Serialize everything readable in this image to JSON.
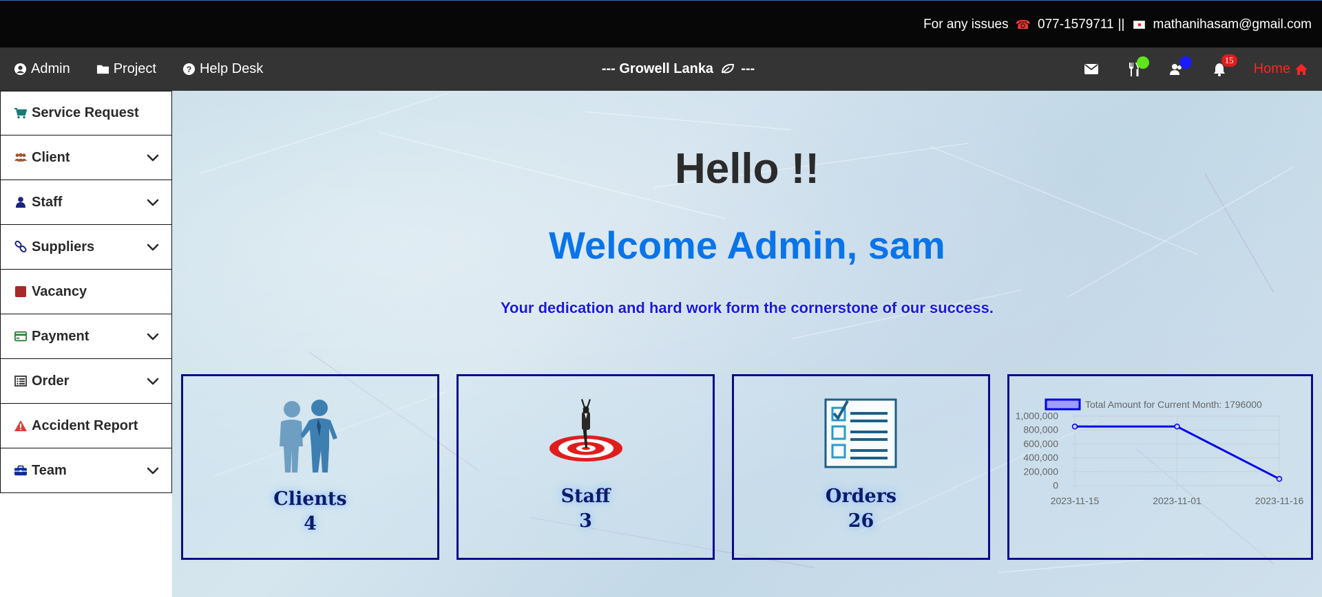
{
  "topbar": {
    "issues_text": "For any issues",
    "phone": "077-1579711",
    "separator": "||",
    "email": "mathanihasam@gmail.com"
  },
  "navbar": {
    "left_items": [
      {
        "label": "Admin",
        "icon": "user-circle-icon"
      },
      {
        "label": "Project",
        "icon": "folder-icon"
      },
      {
        "label": "Help Desk",
        "icon": "question-circle-icon"
      }
    ],
    "title": "--- Growell Lanka",
    "title_suffix": "---",
    "icons": [
      {
        "name": "envelope-icon"
      },
      {
        "name": "utensils-icon",
        "dot_color": "#5ee61a"
      },
      {
        "name": "users-icon",
        "dot_color": "#1a1aff"
      },
      {
        "name": "bell-icon",
        "badge": "15"
      }
    ],
    "home_label": "Home",
    "home_color": "#ff2424"
  },
  "sidebar": {
    "items": [
      {
        "label": "Service Request",
        "icon": "cart-icon",
        "icon_color": "#1b7a7a",
        "has_dropdown": false
      },
      {
        "label": "Client",
        "icon": "users-icon",
        "icon_color": "#a0522d",
        "has_dropdown": true
      },
      {
        "label": "Staff",
        "icon": "user-icon",
        "icon_color": "#1a237e",
        "has_dropdown": true
      },
      {
        "label": "Suppliers",
        "icon": "link-icon",
        "icon_color": "#1a237e",
        "has_dropdown": true
      },
      {
        "label": "Vacancy",
        "icon": "square-icon",
        "icon_color": "#a52a2a",
        "has_dropdown": false
      },
      {
        "label": "Payment",
        "icon": "credit-card-icon",
        "icon_color": "#2e7d32",
        "has_dropdown": true
      },
      {
        "label": "Order",
        "icon": "list-alt-icon",
        "icon_color": "#333333",
        "has_dropdown": true
      },
      {
        "label": "Accident Report",
        "icon": "warning-icon",
        "icon_color": "#e53935",
        "has_dropdown": false
      },
      {
        "label": "Team",
        "icon": "briefcase-icon",
        "icon_color": "#0d2a9e",
        "has_dropdown": true
      }
    ]
  },
  "main": {
    "hello": "Hello !!",
    "welcome": "Welcome Admin, sam",
    "tagline": "Your dedication and hard work form the cornerstone of our success."
  },
  "cards": [
    {
      "label": "Clients",
      "value": "4",
      "icon": "handshake-people-icon"
    },
    {
      "label": "Staff",
      "value": "3",
      "icon": "target-person-icon"
    },
    {
      "label": "Orders",
      "value": "26",
      "icon": "checklist-icon"
    }
  ],
  "chart_data": {
    "type": "line",
    "categories": [
      "2023-11-15",
      "2023-11-01",
      "2023-11-16"
    ],
    "series": [
      {
        "name": "Total Amount for Current Month: 1796000",
        "values": [
          850000,
          850000,
          96000
        ],
        "color": "#0000ee"
      }
    ],
    "ylim": [
      0,
      1000000
    ],
    "yticks": [
      "0",
      "200,000",
      "400,000",
      "600,000",
      "800,000",
      "1,000,000"
    ],
    "ytick_values": [
      0,
      200000,
      400000,
      600000,
      800000,
      1000000
    ],
    "grid": true,
    "legend": "top"
  }
}
